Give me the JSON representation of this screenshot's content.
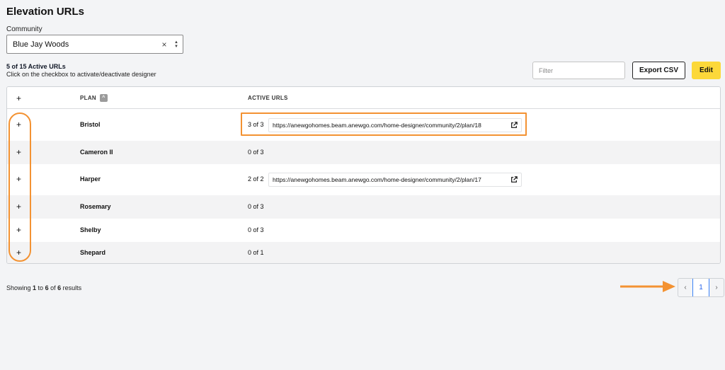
{
  "page_title": "Elevation URLs",
  "community": {
    "label": "Community",
    "value": "Blue Jay Woods",
    "clear_glyph": "×",
    "updown_up": "▲",
    "updown_down": "▼"
  },
  "summary": {
    "active": "5 of 15 Active URLs",
    "hint": "Click on the checkbox to activate/deactivate designer"
  },
  "toolbar": {
    "filter_placeholder": "Filter",
    "export_label": "Export CSV",
    "edit_label": "Edit"
  },
  "table": {
    "expand_glyph": "+",
    "headers": {
      "plan": "PLAN",
      "active_urls": "ACTIVE URLS",
      "sort_glyph": "^"
    },
    "rows": [
      {
        "plan": "Bristol",
        "count": "3 of 3",
        "url": "https://anewgohomes.beam.anewgo.com/home-designer/community/2/plan/18"
      },
      {
        "plan": "Cameron II",
        "count": "0 of 3",
        "url": ""
      },
      {
        "plan": "Harper",
        "count": "2 of 2",
        "url": "https://anewgohomes.beam.anewgo.com/home-designer/community/2/plan/17"
      },
      {
        "plan": "Rosemary",
        "count": "0 of 3",
        "url": ""
      },
      {
        "plan": "Shelby",
        "count": "0 of 3",
        "url": ""
      },
      {
        "plan": "Shepard",
        "count": "0 of 1",
        "url": ""
      }
    ]
  },
  "results": {
    "prefix": "Showing ",
    "from": "1",
    "mid1": " to ",
    "to": "6",
    "mid2": " of ",
    "total": "6",
    "suffix": " results"
  },
  "pagination": {
    "prev": "‹",
    "current": "1",
    "next": "›"
  },
  "colors": {
    "highlight": "#f39232",
    "edit_button": "#fcd83a",
    "current_page": "#2563eb"
  },
  "icons": {
    "external_link": "external-link-icon",
    "arrow": "arrow-right-icon"
  }
}
